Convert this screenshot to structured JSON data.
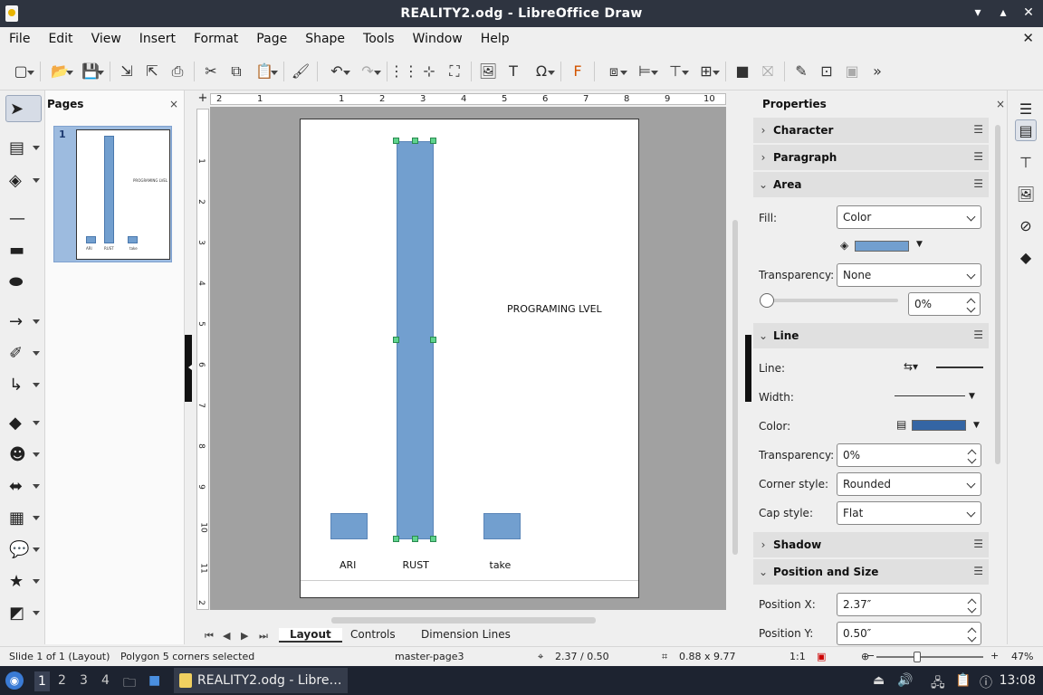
{
  "window": {
    "title": "REALITY2.odg - LibreOffice Draw",
    "min": "▾",
    "max": "▴",
    "close": "✕"
  },
  "menu": {
    "items": [
      "File",
      "Edit",
      "View",
      "Insert",
      "Format",
      "Page",
      "Shape",
      "Tools",
      "Window",
      "Help"
    ],
    "close_doc": "✕"
  },
  "pages_pane": {
    "title": "Pages",
    "close": "×",
    "thumb_number": "1",
    "thumb_text": "PROGRAMING LVEL",
    "thumb_labels": [
      "ARI",
      "RUST",
      "take"
    ]
  },
  "ruler": {
    "top_ticks": [
      "2",
      "1",
      "1",
      "2",
      "3",
      "4",
      "5",
      "6",
      "7",
      "8",
      "9",
      "10"
    ],
    "left_ticks": [
      "1",
      "2",
      "3",
      "4",
      "5",
      "6",
      "7",
      "8",
      "9",
      "10",
      "11",
      "2"
    ]
  },
  "drawing": {
    "title_text": "PROGRAMING LVEL",
    "labels": [
      "ARI",
      "RUST",
      "take"
    ]
  },
  "chart_data": {
    "type": "bar",
    "categories": [
      "ARI",
      "RUST",
      "take"
    ],
    "values": [
      1,
      15,
      1
    ],
    "title": "PROGRAMING LVEL",
    "xlabel": "",
    "ylabel": ""
  },
  "tabs": {
    "items": [
      "Layout",
      "Controls",
      "Dimension Lines"
    ],
    "active": "Layout"
  },
  "sidebar": {
    "title": "Properties",
    "close": "×",
    "sections": {
      "character": "Character",
      "paragraph": "Paragraph",
      "area": "Area",
      "line": "Line",
      "shadow": "Shadow",
      "position": "Position and Size"
    },
    "area": {
      "fill_label": "Fill:",
      "fill_value": "Color",
      "fill_color": "#729fcf",
      "transparency_label": "Transparency:",
      "transparency_value": "None",
      "transparency_pct": "0%"
    },
    "line": {
      "line_label": "Line:",
      "width_label": "Width:",
      "color_label": "Color:",
      "line_color": "#3465a4",
      "transparency_label": "Transparency:",
      "transparency_value": "0%",
      "corner_label": "Corner style:",
      "corner_value": "Rounded",
      "cap_label": "Cap style:",
      "cap_value": "Flat"
    },
    "position": {
      "x_label": "Position X:",
      "x_value": "2.37″",
      "y_label": "Position Y:",
      "y_value": "0.50″"
    }
  },
  "status": {
    "slide": "Slide 1 of 1 (Layout)",
    "selection": "Polygon 5 corners selected",
    "master": "master-page3",
    "position": "2.37 / 0.50",
    "size": "0.88 x 9.77",
    "scale": "1:1",
    "zoom": "47%"
  },
  "taskbar": {
    "workspaces": [
      "1",
      "2",
      "3",
      "4"
    ],
    "current_workspace": "1",
    "task_label": "REALITY2.odg - Libre…",
    "clock": "13:08"
  }
}
